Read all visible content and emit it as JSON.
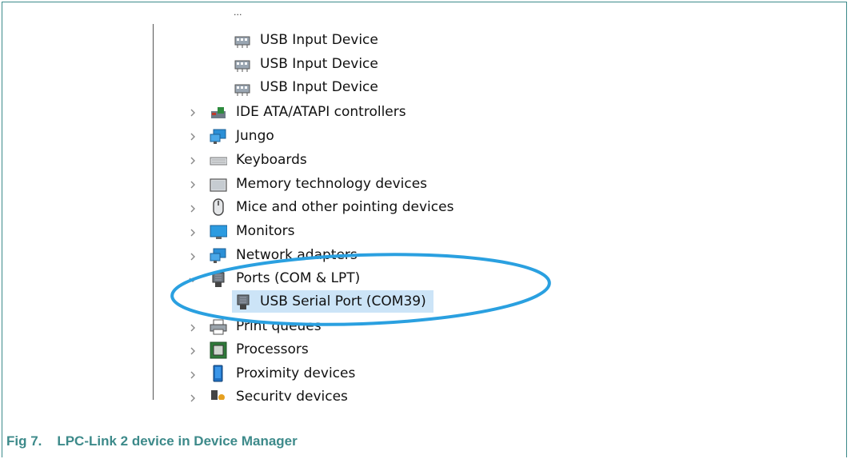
{
  "tree": {
    "partial_top": "...",
    "hid_children": [
      {
        "label": "USB Input Device",
        "icon": "hid-device-icon"
      },
      {
        "label": "USB Input Device",
        "icon": "hid-device-icon"
      },
      {
        "label": "USB Input Device",
        "icon": "hid-device-icon"
      }
    ],
    "categories": [
      {
        "label": "IDE ATA/ATAPI controllers",
        "icon": "ide-controller-icon",
        "expanded": false
      },
      {
        "label": "Jungo",
        "icon": "jungo-network-icon",
        "expanded": false
      },
      {
        "label": "Keyboards",
        "icon": "keyboard-icon",
        "expanded": false
      },
      {
        "label": "Memory technology devices",
        "icon": "memory-device-icon",
        "expanded": false
      },
      {
        "label": "Mice and other pointing devices",
        "icon": "mouse-icon",
        "expanded": false
      },
      {
        "label": "Monitors",
        "icon": "monitor-icon",
        "expanded": false
      },
      {
        "label": "Network adapters",
        "icon": "network-adapter-icon",
        "expanded": false
      },
      {
        "label": "Ports (COM & LPT)",
        "icon": "port-icon",
        "expanded": true
      },
      {
        "label": "Print queues",
        "icon": "printer-icon",
        "expanded": false
      },
      {
        "label": "Processors",
        "icon": "processor-icon",
        "expanded": false
      },
      {
        "label": "Proximity devices",
        "icon": "proximity-device-icon",
        "expanded": false
      },
      {
        "label": "Security devices",
        "icon": "security-device-icon",
        "expanded": false
      }
    ],
    "selected_child": {
      "label": "USB Serial Port (COM39)",
      "icon": "serial-port-icon"
    }
  },
  "caption": {
    "label": "Fig 7.",
    "text": "LPC-Link 2 device in Device Manager"
  },
  "colors": {
    "caption": "#3d8a8a",
    "highlight_ellipse": "#2aa0e0",
    "selection": "#cce4f7"
  }
}
